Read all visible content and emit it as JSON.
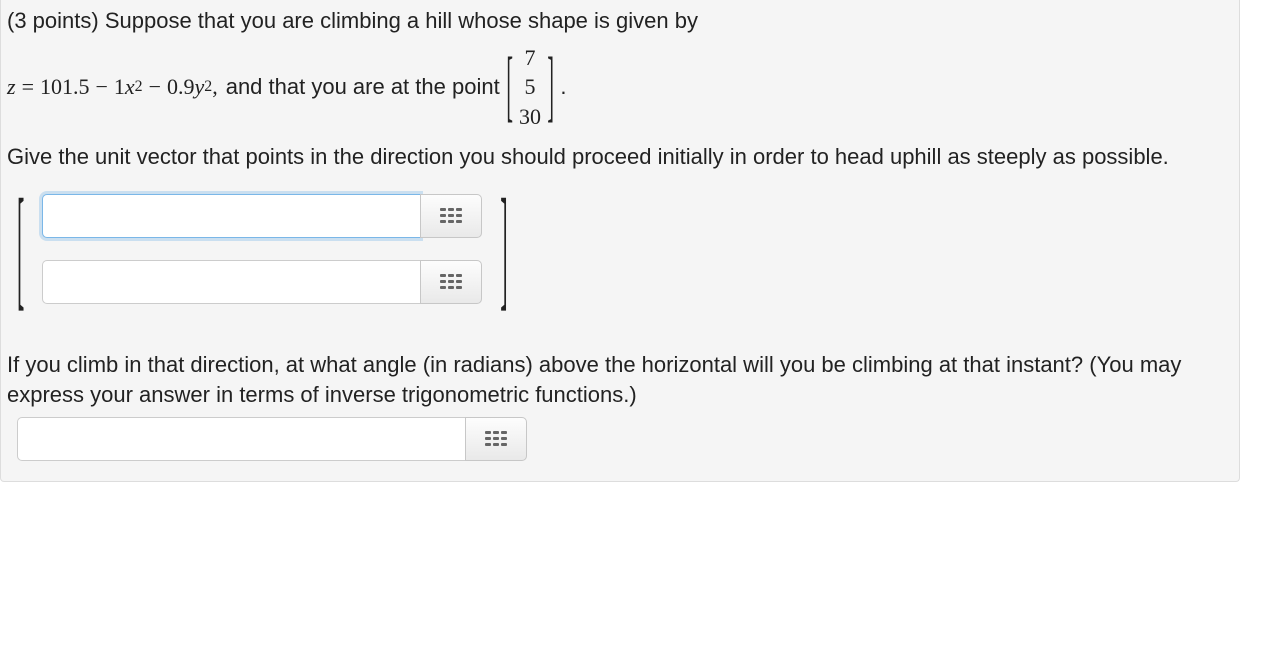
{
  "question": {
    "pointsLabel": "(3 points)",
    "intro": "Suppose that you are climbing a hill whose shape is given by",
    "equation": {
      "lhs_var": "z",
      "eq": "=",
      "c0": "101.5",
      "minus": "−",
      "c1": "1",
      "x": "x",
      "sq": "2",
      "c2": "0.9",
      "y": "y",
      "comma": ","
    },
    "midText": "and that you are at the point",
    "pointVec": [
      "7",
      "5",
      "30"
    ],
    "period": ".",
    "part1": "Give the unit vector that points in the direction you should proceed initially in order to head uphill as steeply as possible.",
    "part2": "If you climb in that direction, at what angle (in radians) above the horizontal will you be climbing at that instant? (You may express your answer in terms of inverse trigonometric functions.)"
  },
  "inputs": {
    "vec0": "",
    "vec1": "",
    "angle": ""
  }
}
